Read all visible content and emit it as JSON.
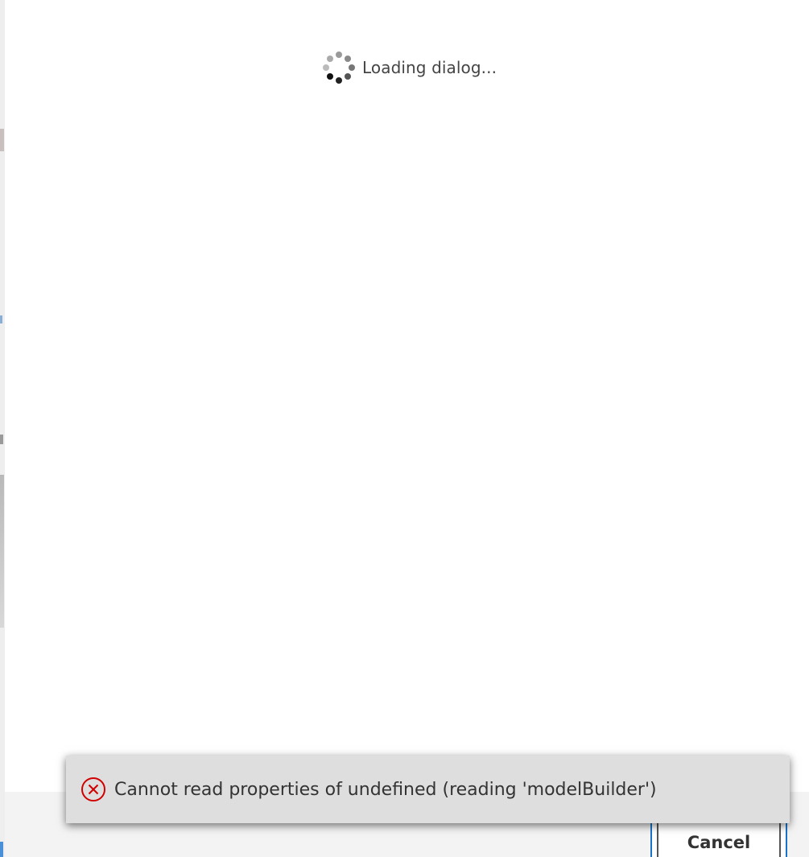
{
  "dialog": {
    "loading_text": "Loading dialog..."
  },
  "toast": {
    "icon": "error-circle-icon",
    "message": "Cannot read properties of undefined (reading 'modelBuilder')",
    "icon_color": "#d10000"
  },
  "footer": {
    "cancel_label": "Cancel",
    "focus_color": "#1a73c9"
  }
}
